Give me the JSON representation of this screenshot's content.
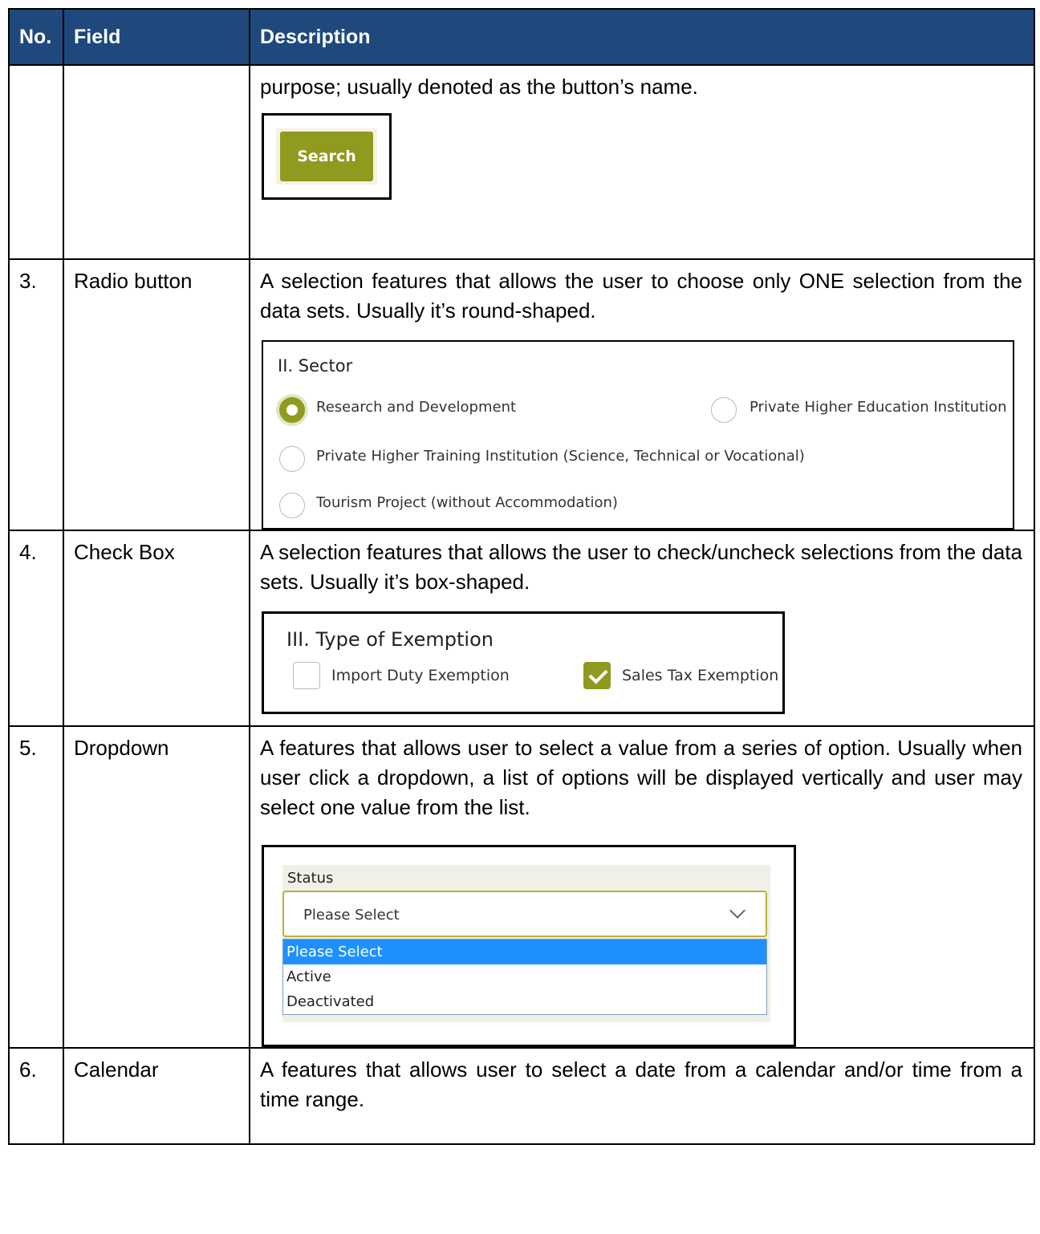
{
  "header": {
    "no": "No.",
    "field": "Field",
    "description": "Description"
  },
  "rows": [
    {
      "no": "",
      "field": "",
      "description": "purpose; usually denoted as the button’s name."
    },
    {
      "no": "3.",
      "field": "Radio button",
      "description": "A selection features that allows the user to choose only ONE selection from the data sets. Usually it’s round-shaped."
    },
    {
      "no": "4.",
      "field": "Check Box",
      "description": "A selection features that allows the user to check/uncheck selections from the data sets. Usually it’s box-shaped."
    },
    {
      "no": "5.",
      "field": "Dropdown",
      "description": "A features that allows user to select a value from a series of option. Usually when user click a dropdown, a list of options will be displayed vertically and user may select one value from the list."
    },
    {
      "no": "6.",
      "field": "Calendar",
      "description": "A features that allows user to select a date from a calendar and/or time from a time range."
    }
  ],
  "examples": {
    "search": {
      "label": "Search",
      "color": "#8f9a1f"
    },
    "radio": {
      "title": "II. Sector",
      "options": [
        "Research and Development",
        "Private Higher Education Institution",
        "Private Higher Training Institution (Science, Technical or Vocational)",
        "Tourism Project (without Accommodation)"
      ],
      "selected": "Research and Development"
    },
    "checkbox": {
      "title": "III. Type of Exemption",
      "options": [
        "Import Duty Exemption",
        "Sales Tax Exemption"
      ],
      "checked": [
        "Sales Tax Exemption"
      ]
    },
    "dropdown": {
      "label": "Status",
      "selected": "Please Select",
      "options": [
        "Please Select",
        "Active",
        "Deactivated"
      ],
      "highlight_color": "#1e90ff"
    }
  },
  "colors": {
    "header_bg": "#1f497d",
    "accent": "#8f9a1f"
  }
}
